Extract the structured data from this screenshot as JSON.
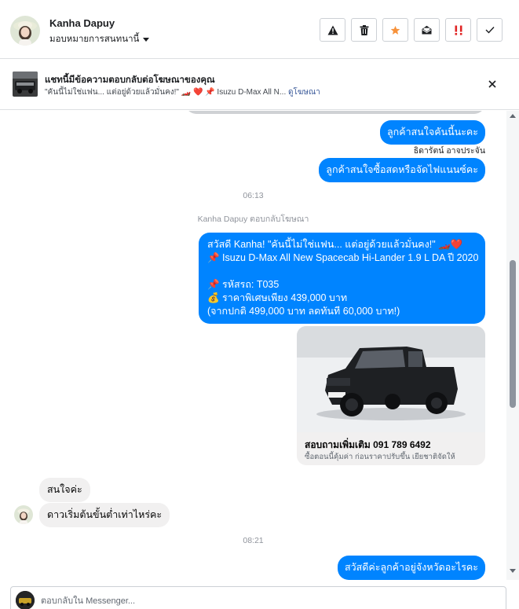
{
  "header": {
    "contact_name": "Kanha Dapuy",
    "assign_label": "มอบหมายการสนทนานี้",
    "actions": [
      "warning-icon",
      "trash-icon",
      "star-icon",
      "envelope-open-icon",
      "spam-icon",
      "check-icon"
    ],
    "colors": {
      "star": "#f7923b",
      "spam": "#e02424"
    }
  },
  "banner": {
    "title": "แชทนี้มีข้อความตอบกลับต่อโฆษณาของคุณ",
    "subtitle": "\"คันนี้ไม่ใช่แฟน... แต่อยู่ด้วยแล้วมั่นคง!\" 🏎️ ❤️ 📌 Isuzu D-Max All N...",
    "link": "ดูโฆษณา"
  },
  "messages": {
    "out1": "ลูกค้าสนใจคันนี้นะคะ",
    "sender": "ธิดารัตน์ อาจประจัน",
    "out2": "ลูกค้าสนใจซื้อสดหรือจัดไฟแนนซ์คะ",
    "time1": "06:13",
    "ad_reply_note": "Kanha Dapuy ตอบกลับโฆษณา",
    "ad_message": {
      "line1": "สวัสดี Kanha! \"คันนี้ไม่ใช่แฟน... แต่อยู่ด้วยแล้วมั่นคง!\" 🏎️❤️",
      "line2": "📌 Isuzu D-Max All New Spacecab Hi-Lander 1.9 L DA ปี 2020",
      "line3": "📌 รหัสรถ: T035",
      "line4": "💰 ราคาพิเศษเพียง 439,000 บาท",
      "line5": "(จากปกติ 499,000 บาท ลดทันที 60,000 บาท!)"
    },
    "card": {
      "title": "สอบถามเพิ่มเติม 091 789 6492",
      "subtitle": "ซื้อตอนนี้คุ้มค่า ก่อนราคาปรับขึ้น เยียชาติจัดให้"
    },
    "in1": "สนใจค่ะ",
    "in2": "ดาวเริ่มต้นขั้นต่ำเท่าไหร่คะ",
    "time2": "08:21",
    "out3": "สวัสดีค่ะลูกค้าอยู่จังหวัดอะไรคะ"
  },
  "composer": {
    "placeholder": "ตอบกลับใน Messenger..."
  }
}
